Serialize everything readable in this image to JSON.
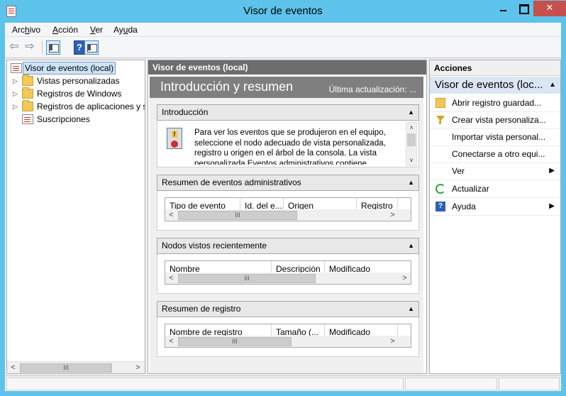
{
  "window": {
    "title": "Visor de eventos",
    "accent_color": "#5ec3ea",
    "close_glyph": "✕"
  },
  "menu": {
    "items": [
      {
        "pre": "Arc",
        "ul": "h",
        "post": "ivo"
      },
      {
        "pre": "",
        "ul": "A",
        "post": "cción"
      },
      {
        "pre": "",
        "ul": "V",
        "post": "er"
      },
      {
        "pre": "Ay",
        "ul": "u",
        "post": "da"
      }
    ]
  },
  "toolbar": {
    "back_icon": "back-arrow-icon",
    "forward_icon": "forward-arrow-icon",
    "help_glyph": "?"
  },
  "tree": {
    "root": "Visor de eventos (local)",
    "items": [
      {
        "label": "Vistas personalizadas",
        "icon": "folder-icon",
        "expander": "▷"
      },
      {
        "label": "Registros de Windows",
        "icon": "folder-icon",
        "expander": "▷"
      },
      {
        "label": "Registros de aplicaciones y s",
        "icon": "folder-icon",
        "expander": "▷"
      },
      {
        "label": "Suscripciones",
        "icon": "logbook-icon",
        "expander": ""
      }
    ],
    "scroll_thumb_glyph": "III"
  },
  "center": {
    "header": "Visor de eventos (local)",
    "banner_title": "Introducción y resumen",
    "banner_updated": "Última actualización: ...",
    "sections": {
      "intro": {
        "title": "Introducción",
        "text": "Para ver los eventos que se produjeron en el equipo, seleccione el nodo adecuado de vista personalizada, registro u origen en el árbol de la consola. La vista personalizada Eventos administrativos contiene todos"
      },
      "admin_summary": {
        "title": "Resumen de eventos administrativos",
        "columns": [
          "Tipo de evento",
          "Id. del e...",
          "Origen",
          "Registro"
        ]
      },
      "recent_nodes": {
        "title": "Nodos vistos recientemente",
        "columns": [
          "Nombre",
          "Descripción",
          "Modificado"
        ]
      },
      "log_summary": {
        "title": "Resumen de registro",
        "columns": [
          "Nombre de registro",
          "Tamaño (...",
          "Modificado"
        ]
      }
    },
    "collapse_glyph": "▲",
    "scroll_thumb_glyph": "III"
  },
  "actions": {
    "header": "Acciones",
    "group": "Visor de eventos (loc...",
    "items": [
      {
        "label": "Abrir registro guardad...",
        "icon": "open-folder-icon",
        "submenu": false
      },
      {
        "label": "Crear vista personaliza...",
        "icon": "filter-icon",
        "submenu": false
      },
      {
        "label": "Importar vista personal...",
        "icon": "",
        "submenu": false
      },
      {
        "label": "Conectarse a otro equi...",
        "icon": "",
        "submenu": false
      },
      {
        "label": "Ver",
        "icon": "",
        "submenu": true
      },
      {
        "label": "Actualizar",
        "icon": "refresh-icon",
        "submenu": false
      },
      {
        "label": "Ayuda",
        "icon": "help-icon",
        "submenu": true
      }
    ]
  }
}
